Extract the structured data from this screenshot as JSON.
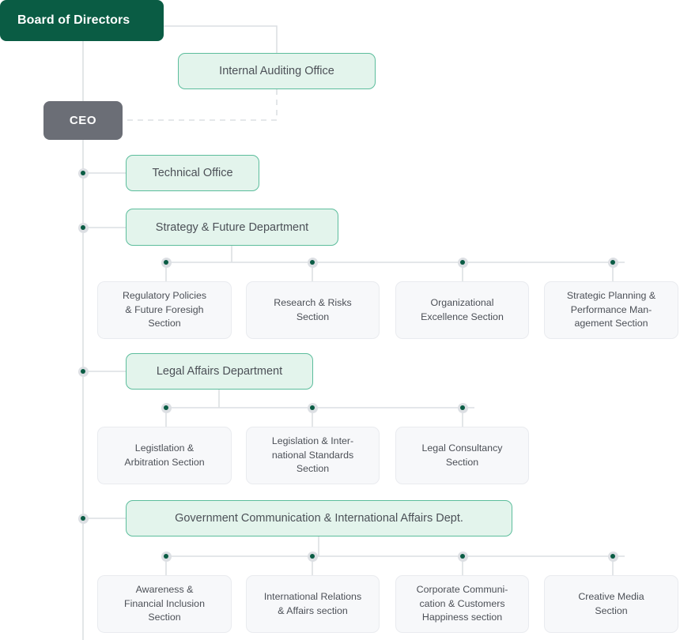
{
  "chart": {
    "title": "Organizational Structure Chart",
    "colors": {
      "root_fill": "#0a5c44",
      "exec_fill": "#6b6e76",
      "dept_fill": "#e3f4ec",
      "dept_border": "#5cbd9c",
      "section_fill": "#f7f8fa",
      "section_border": "#e9ebef",
      "line": "#dcdfe3",
      "dot_core": "#0a5c44",
      "dot_ring": "#dcdfe3",
      "text_dark": "#4c5057",
      "text_light": "#ffffff"
    }
  },
  "nodes": {
    "board": {
      "label": "Board of Directors",
      "type": "root"
    },
    "internal_auditing": {
      "label": "Internal Auditing Office",
      "type": "office"
    },
    "ceo": {
      "label": "CEO",
      "type": "exec"
    },
    "technical_office": {
      "label": "Technical Office",
      "type": "office"
    },
    "strategy_dept": {
      "label": "Strategy & Future Department",
      "type": "department"
    },
    "legal_dept": {
      "label": "Legal Affairs Department",
      "type": "department"
    },
    "govcomm_dept": {
      "label": "Government Communication & International Affairs Dept.",
      "type": "department"
    }
  },
  "strategy_sections": [
    {
      "label": "Regulatory Policies\n& Future Foresigh\nSection"
    },
    {
      "label": "Research & Risks\nSection"
    },
    {
      "label": "Organizational\nExcellence Section"
    },
    {
      "label": "Strategic Planning &\nPerformance Man-\nagement Section"
    }
  ],
  "legal_sections": [
    {
      "label": "Legistlation &\nArbitration Section"
    },
    {
      "label": "Legislation & Inter-\nnational Standards\nSection"
    },
    {
      "label": "Legal Consultancy\nSection"
    }
  ],
  "govcomm_sections": [
    {
      "label": "Awareness &\nFinancial Inclusion\nSection"
    },
    {
      "label": "International Relations\n& Affairs section"
    },
    {
      "label": "Corporate Communi-\ncation & Customers\nHappiness section"
    },
    {
      "label": "Creative Media\nSection"
    }
  ]
}
